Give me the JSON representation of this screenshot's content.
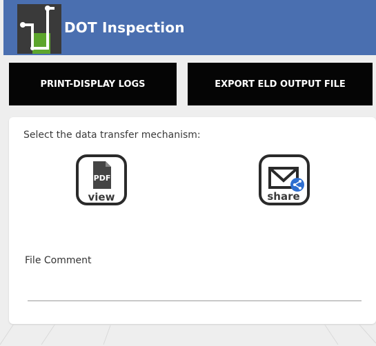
{
  "header": {
    "title": "DOT Inspection",
    "bg_color": "#4a6fb0",
    "logo_icon": "eld-logo-icon"
  },
  "actions": {
    "print_label": "PRINT-DISPLAY LOGS",
    "export_label": "EXPORT ELD OUTPUT FILE"
  },
  "transfer": {
    "prompt": "Select the data transfer mechanism:",
    "pdf_icon_text": "PDF",
    "pdf_button_label": "view",
    "share_button_label": "share"
  },
  "comment": {
    "label": "File Comment",
    "value": "",
    "placeholder": ""
  }
}
